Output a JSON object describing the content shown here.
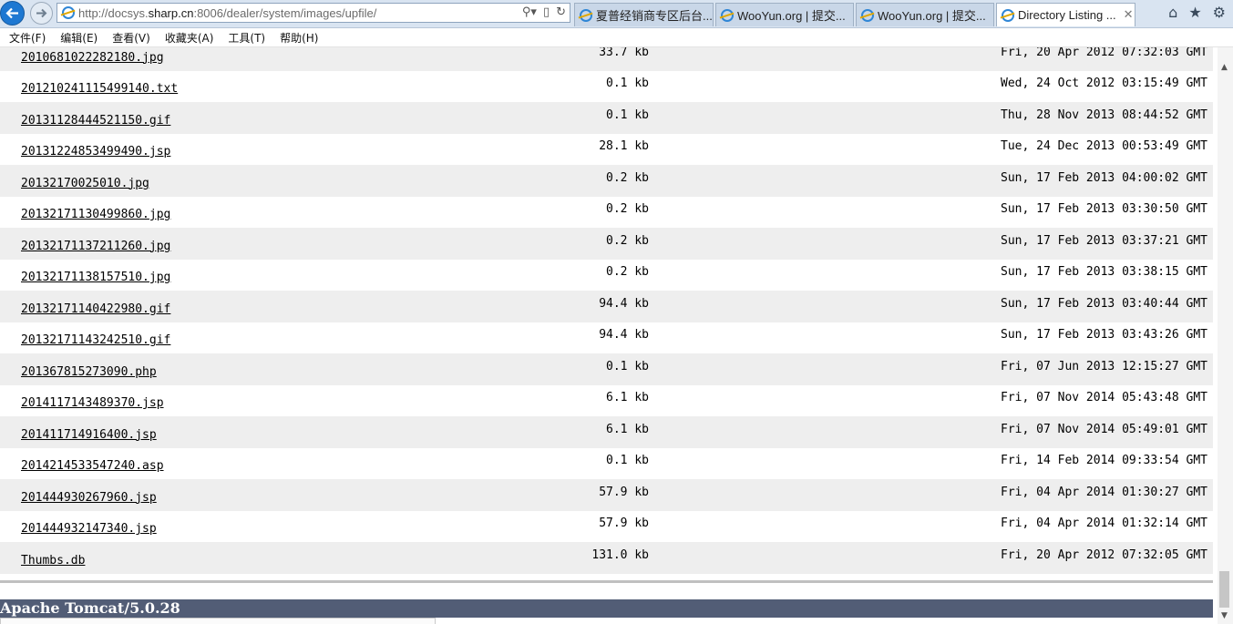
{
  "browser": {
    "url_prefix": "http://docsys.",
    "url_host": "sharp.cn",
    "url_suffix": ":8006/dealer/system/images/upfile/",
    "tabs": [
      {
        "title": "夏普经销商专区后台..."
      },
      {
        "title": "WooYun.org | 提交..."
      },
      {
        "title": "WooYun.org | 提交..."
      },
      {
        "title": "Directory Listing ..."
      }
    ],
    "menu": [
      "文件(F)",
      "编辑(E)",
      "查看(V)",
      "收藏夹(A)",
      "工具(T)",
      "帮助(H)"
    ]
  },
  "files": [
    {
      "name": "2010681022282180.jpg",
      "size": "33.7 kb",
      "date": "Fri, 20 Apr 2012 07:32:03 GMT"
    },
    {
      "name": "201210241115499140.txt",
      "size": "0.1 kb",
      "date": "Wed, 24 Oct 2012 03:15:49 GMT"
    },
    {
      "name": "20131128444521150.gif",
      "size": "0.1 kb",
      "date": "Thu, 28 Nov 2013 08:44:52 GMT"
    },
    {
      "name": "20131224853499490.jsp",
      "size": "28.1 kb",
      "date": "Tue, 24 Dec 2013 00:53:49 GMT"
    },
    {
      "name": "20132170025010.jpg",
      "size": "0.2 kb",
      "date": "Sun, 17 Feb 2013 04:00:02 GMT"
    },
    {
      "name": "20132171130499860.jpg",
      "size": "0.2 kb",
      "date": "Sun, 17 Feb 2013 03:30:50 GMT"
    },
    {
      "name": "20132171137211260.jpg",
      "size": "0.2 kb",
      "date": "Sun, 17 Feb 2013 03:37:21 GMT"
    },
    {
      "name": "20132171138157510.jpg",
      "size": "0.2 kb",
      "date": "Sun, 17 Feb 2013 03:38:15 GMT"
    },
    {
      "name": "20132171140422980.gif",
      "size": "94.4 kb",
      "date": "Sun, 17 Feb 2013 03:40:44 GMT"
    },
    {
      "name": "20132171143242510.gif",
      "size": "94.4 kb",
      "date": "Sun, 17 Feb 2013 03:43:26 GMT"
    },
    {
      "name": "201367815273090.php",
      "size": "0.1 kb",
      "date": "Fri, 07 Jun 2013 12:15:27 GMT"
    },
    {
      "name": "2014117143489370.jsp",
      "size": "6.1 kb",
      "date": "Fri, 07 Nov 2014 05:43:48 GMT"
    },
    {
      "name": "201411714916400.jsp",
      "size": "6.1 kb",
      "date": "Fri, 07 Nov 2014 05:49:01 GMT"
    },
    {
      "name": "2014214533547240.asp",
      "size": "0.1 kb",
      "date": "Fri, 14 Feb 2014 09:33:54 GMT"
    },
    {
      "name": "201444930267960.jsp",
      "size": "57.9 kb",
      "date": "Fri, 04 Apr 2014 01:30:27 GMT"
    },
    {
      "name": "201444932147340.jsp",
      "size": "57.9 kb",
      "date": "Fri, 04 Apr 2014 01:32:14 GMT"
    },
    {
      "name": "Thumbs.db",
      "size": "131.0 kb",
      "date": "Fri, 20 Apr 2012 07:32:05 GMT"
    }
  ],
  "footer": {
    "server": "Apache Tomcat/5.0.28"
  },
  "colors": {
    "footer_bg": "#525d76",
    "row_alt": "#eeeeee",
    "back_button": "#1e78d2"
  }
}
